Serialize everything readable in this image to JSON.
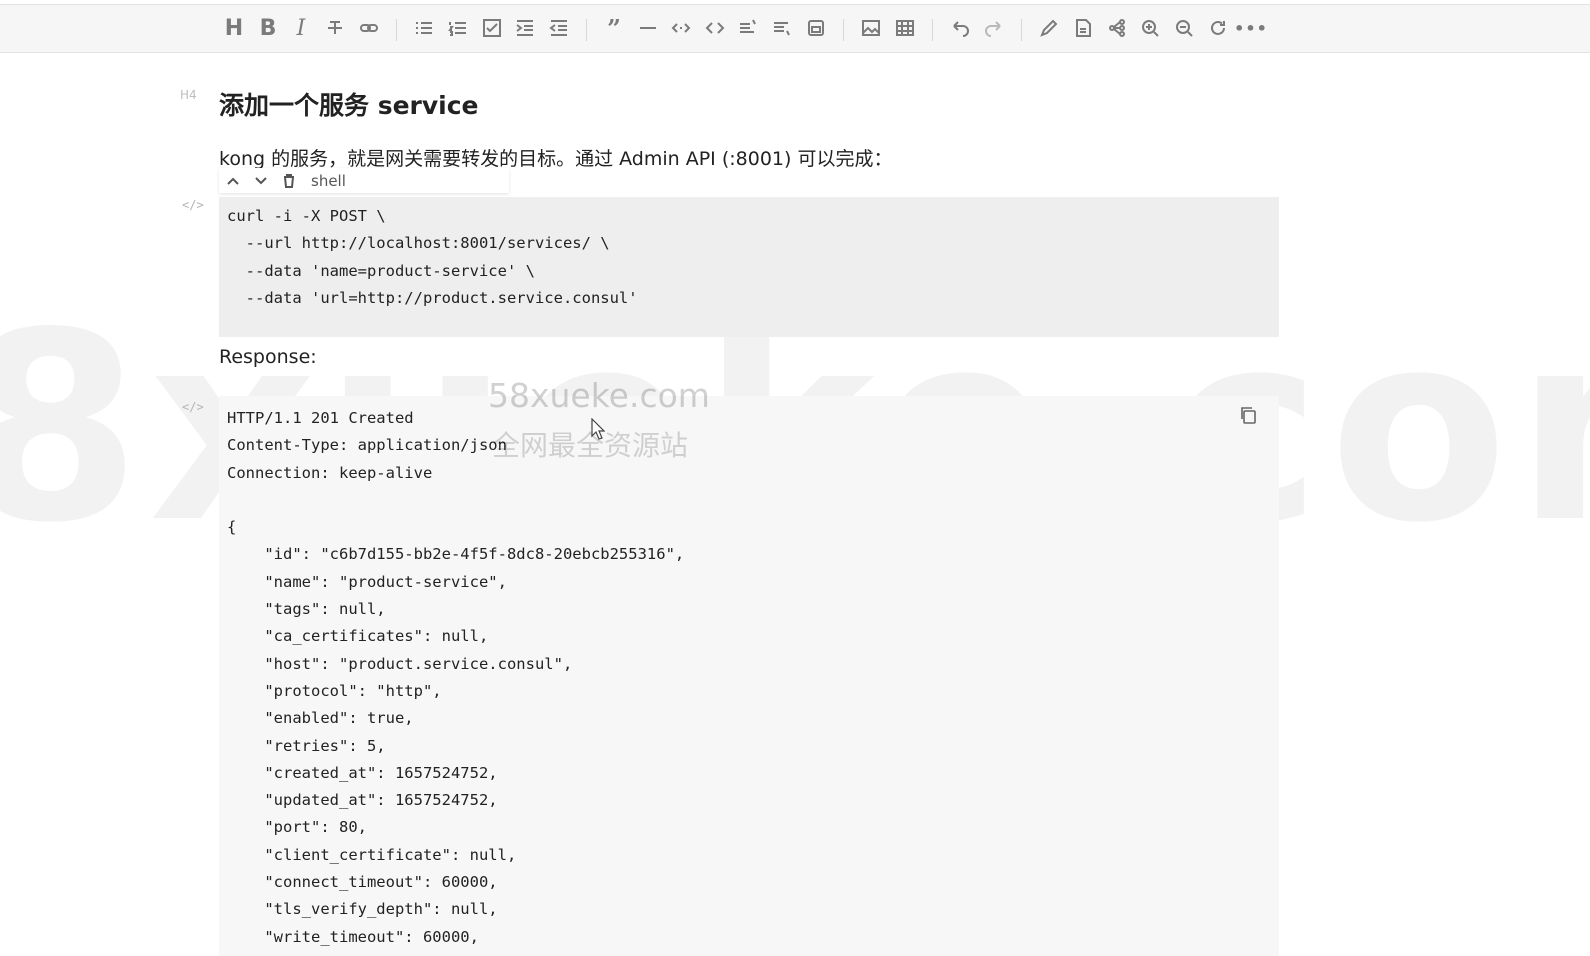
{
  "toolbar": {
    "icons": [
      "heading-icon",
      "bold-icon",
      "italic-icon",
      "strikethrough-icon",
      "link-icon",
      "unordered-list-icon",
      "ordered-list-icon",
      "task-list-icon",
      "indent-icon",
      "outdent-icon",
      "quote-icon",
      "horizontal-rule-icon",
      "inline-code-icon",
      "code-block-icon",
      "insert-before-icon",
      "insert-after-icon",
      "export-icon",
      "image-icon",
      "table-icon",
      "undo-icon",
      "redo-icon",
      "edit-icon",
      "pdf-icon",
      "mindmap-icon",
      "zoom-in-icon",
      "zoom-out-icon",
      "refresh-icon",
      "more-icon"
    ]
  },
  "content": {
    "heading_marker": "H4",
    "heading": "添加一个服务 service",
    "paragraph": "kong 的服务，就是网关需要转发的目标。通过 Admin API (:8001) 可以完成：",
    "code_marker": "</>",
    "code_tools": {
      "language": "shell"
    },
    "code1": [
      "curl -i -X POST \\",
      "  --url http://localhost:8001/services/ \\",
      "  --data 'name=product-service' \\",
      "  --data 'url=http://product.service.consul'"
    ],
    "response_label": "Response:",
    "response": [
      "HTTP/1.1 201 Created",
      "Content-Type: application/json",
      "Connection: keep-alive",
      "",
      "{",
      "    \"id\": \"c6b7d155-bb2e-4f5f-8dc8-20ebcb255316\",",
      "    \"name\": \"product-service\",",
      "    \"tags\": null,",
      "    \"ca_certificates\": null,",
      "    \"host\": \"product.service.consul\",",
      "    \"protocol\": \"http\",",
      "    \"enabled\": true,",
      "    \"retries\": 5,",
      "    \"created_at\": 1657524752,",
      "    \"updated_at\": 1657524752,",
      "    \"port\": 80,",
      "    \"client_certificate\": null,",
      "    \"connect_timeout\": 60000,",
      "    \"tls_verify_depth\": null,",
      "    \"write_timeout\": 60000,"
    ]
  },
  "watermark": {
    "big": "8xueke.com",
    "line1": "58xueke.com",
    "line2": "全网最全资源站"
  }
}
